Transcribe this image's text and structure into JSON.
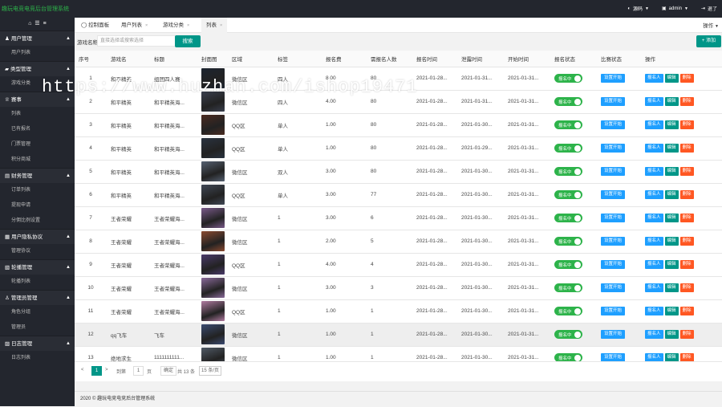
{
  "header": {
    "brand": "趣玩电竞电竞后台管理系统",
    "lang_label": "源码",
    "user_label": "admin",
    "exit_label": "退了"
  },
  "sidebar": {
    "groups": [
      {
        "label": "用户管理",
        "icon": "user-icon",
        "items": [
          "用户列表"
        ]
      },
      {
        "label": "类型管理",
        "icon": "folder-icon",
        "items": [
          "游戏分类"
        ]
      },
      {
        "label": "赛事",
        "icon": "trophy-icon",
        "items": [
          "列表",
          "已有报名",
          "门票管理",
          "积分商城"
        ]
      },
      {
        "label": "财务管理",
        "icon": "wallet-icon",
        "items": [
          "订单列表",
          "提现申请",
          "分佣比例设置"
        ]
      },
      {
        "label": "用户隐私协议",
        "icon": "document-icon",
        "items": [
          "管理协议"
        ]
      },
      {
        "label": "轮播管理",
        "icon": "image-icon",
        "items": [
          "轮播列表"
        ]
      },
      {
        "label": "管理员管理",
        "icon": "admin-icon",
        "items": [
          "角色分组",
          "管理员"
        ]
      },
      {
        "label": "日志管理",
        "icon": "log-icon",
        "items": [
          "日志列表"
        ]
      }
    ]
  },
  "tabs": [
    {
      "label": "控制面板"
    },
    {
      "label": "用户列表"
    },
    {
      "label": "游戏分类"
    },
    {
      "label": "列表"
    }
  ],
  "operate_label": "操作",
  "search": {
    "label": "游戏名称:",
    "placeholder": "直接选择或搜索选择",
    "button": "搜索",
    "add": "+ 添加"
  },
  "table": {
    "headers": [
      "序号",
      "游戏名",
      "标题",
      "封面图",
      "区域",
      "标签",
      "报名费",
      "需报名人数",
      "报名时间",
      "泄露时间",
      "开始时间",
      "报名状态",
      "比赛状态",
      "操作"
    ],
    "status_label": "报名中",
    "state_label": "设置开始",
    "actions": [
      "报名人",
      "编辑",
      "删除"
    ],
    "rows": [
      {
        "id": "1",
        "game": "和平精英",
        "title": "组团四人赛",
        "region": "微信区",
        "tag": "四人",
        "fee": "8.00",
        "need": "80",
        "signup": "2021-01-28...",
        "leak": "2021-01-31...",
        "start": "2021-01-31...",
        "color": "#1c2430"
      },
      {
        "id": "2",
        "game": "和平精英",
        "title": "和平精英海...",
        "region": "微信区",
        "tag": "四人",
        "fee": "4.00",
        "need": "80",
        "signup": "2021-01-28...",
        "leak": "2021-01-31...",
        "start": "2021-01-31...",
        "color": "#3a3f4d"
      },
      {
        "id": "3",
        "game": "和平精英",
        "title": "和平精英海...",
        "region": "QQ区",
        "tag": "单人",
        "fee": "1.00",
        "need": "80",
        "signup": "2021-01-28...",
        "leak": "2021-01-30...",
        "start": "2021-01-31...",
        "color": "#4a2a20"
      },
      {
        "id": "4",
        "game": "和平精英",
        "title": "和平精英海...",
        "region": "QQ区",
        "tag": "单人",
        "fee": "1.00",
        "need": "80",
        "signup": "2021-01-28...",
        "leak": "2021-01-29...",
        "start": "2021-01-31...",
        "color": "#2a3340"
      },
      {
        "id": "5",
        "game": "和平精英",
        "title": "和平精英海...",
        "region": "微信区",
        "tag": "双人",
        "fee": "3.00",
        "need": "80",
        "signup": "2021-01-28...",
        "leak": "2021-01-30...",
        "start": "2021-01-31...",
        "color": "#556070"
      },
      {
        "id": "6",
        "game": "和平精英",
        "title": "和平精英海...",
        "region": "QQ区",
        "tag": "单人",
        "fee": "3.00",
        "need": "77",
        "signup": "2021-01-28...",
        "leak": "2021-01-30...",
        "start": "2021-01-31...",
        "color": "#404855"
      },
      {
        "id": "7",
        "game": "王者荣耀",
        "title": "王者荣耀海...",
        "region": "微信区",
        "tag": "1",
        "fee": "3.00",
        "need": "6",
        "signup": "2021-01-28...",
        "leak": "2021-01-30...",
        "start": "2021-01-31...",
        "color": "#7a5a8a"
      },
      {
        "id": "8",
        "game": "王者荣耀",
        "title": "王者荣耀海...",
        "region": "微信区",
        "tag": "1",
        "fee": "2.00",
        "need": "5",
        "signup": "2021-01-28...",
        "leak": "2021-01-30...",
        "start": "2021-01-31...",
        "color": "#8a4a30"
      },
      {
        "id": "9",
        "game": "王者荣耀",
        "title": "王者荣耀海...",
        "region": "QQ区",
        "tag": "1",
        "fee": "4.00",
        "need": "4",
        "signup": "2021-01-28...",
        "leak": "2021-01-30...",
        "start": "2021-01-31...",
        "color": "#4a3a6a"
      },
      {
        "id": "10",
        "game": "王者荣耀",
        "title": "王者荣耀海...",
        "region": "微信区",
        "tag": "1",
        "fee": "3.00",
        "need": "3",
        "signup": "2021-01-28...",
        "leak": "2021-01-30...",
        "start": "2021-01-31...",
        "color": "#8a6a9a"
      },
      {
        "id": "11",
        "game": "王者荣耀",
        "title": "王者荣耀海...",
        "region": "QQ区",
        "tag": "1",
        "fee": "1.00",
        "need": "1",
        "signup": "2021-01-28...",
        "leak": "2021-01-30...",
        "start": "2021-01-31...",
        "color": "#b07aa0"
      },
      {
        "id": "12",
        "game": "qq飞车",
        "title": "飞车",
        "region": "微信区",
        "tag": "1",
        "fee": "1.00",
        "need": "1",
        "signup": "2021-01-28...",
        "leak": "2021-01-30...",
        "start": "2021-01-31...",
        "color": "#3a4a70"
      },
      {
        "id": "13",
        "game": "绝地求生",
        "title": "1111111111...",
        "region": "微信区",
        "tag": "1",
        "fee": "1.00",
        "need": "1",
        "signup": "2021-01-28...",
        "leak": "2021-01-30...",
        "start": "2021-01-31...",
        "color": "#505a66"
      }
    ]
  },
  "pager": {
    "prev": "<",
    "current": "1",
    "next": ">",
    "to_label": "到第",
    "input": "1",
    "page_label": "页",
    "go": "确定",
    "total": "共 13 条",
    "size": "15 条/页"
  },
  "footer": "2020 © 趣玩电竞电竞后台管理系统",
  "watermark": "https://www.huzhan.com/ishop19471"
}
